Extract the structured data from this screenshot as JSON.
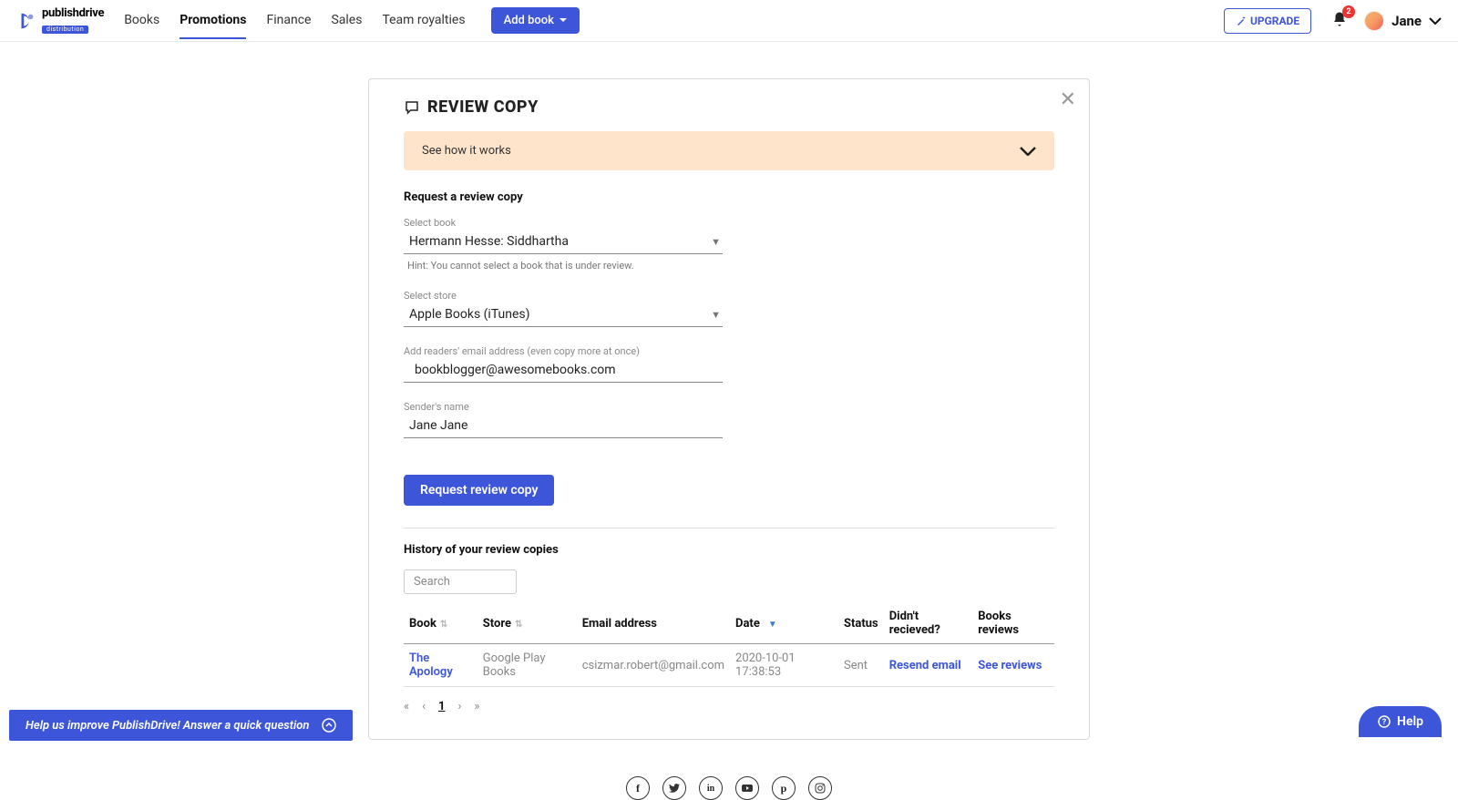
{
  "brand": {
    "name": "publishdrive",
    "tagline": "distribution"
  },
  "nav": {
    "items": [
      {
        "label": "Books"
      },
      {
        "label": "Promotions"
      },
      {
        "label": "Finance"
      },
      {
        "label": "Sales"
      },
      {
        "label": "Team royalties"
      }
    ],
    "add_book": "Add book",
    "upgrade": "UPGRADE",
    "notifications_count": "2",
    "user_name": "Jane"
  },
  "card": {
    "title": "REVIEW COPY",
    "how_it_works": "See how it works",
    "request_heading": "Request a review copy",
    "fields": {
      "select_book_label": "Select book",
      "select_book_value": "Hermann Hesse: Siddhartha",
      "select_book_hint": "Hint: You cannot select a book that is under review.",
      "select_store_label": "Select store",
      "select_store_value": "Apple Books (iTunes)",
      "email_label": "Add readers' email address (even copy more at once)",
      "email_value": "bookblogger@awesomebooks.com",
      "sender_label": "Sender's name",
      "sender_value": "Jane Jane"
    },
    "request_button": "Request review copy",
    "history_heading": "History of your review copies",
    "search_placeholder": "Search",
    "columns": {
      "book": "Book",
      "store": "Store",
      "email": "Email address",
      "date": "Date",
      "status": "Status",
      "didnt": "Didn't recieved?",
      "reviews": "Books reviews"
    },
    "rows": [
      {
        "book": "The Apology",
        "store": "Google Play Books",
        "email": "csizmar.robert@gmail.com",
        "date": "2020-10-01 17:38:53",
        "status": "Sent",
        "resend": "Resend email",
        "see": "See reviews"
      }
    ],
    "page_current": "1"
  },
  "feedback_bar": "Help us improve PublishDrive! Answer a quick question",
  "help_label": "Help",
  "social": [
    "f",
    "t",
    "in",
    "▶",
    "p",
    "ig"
  ]
}
